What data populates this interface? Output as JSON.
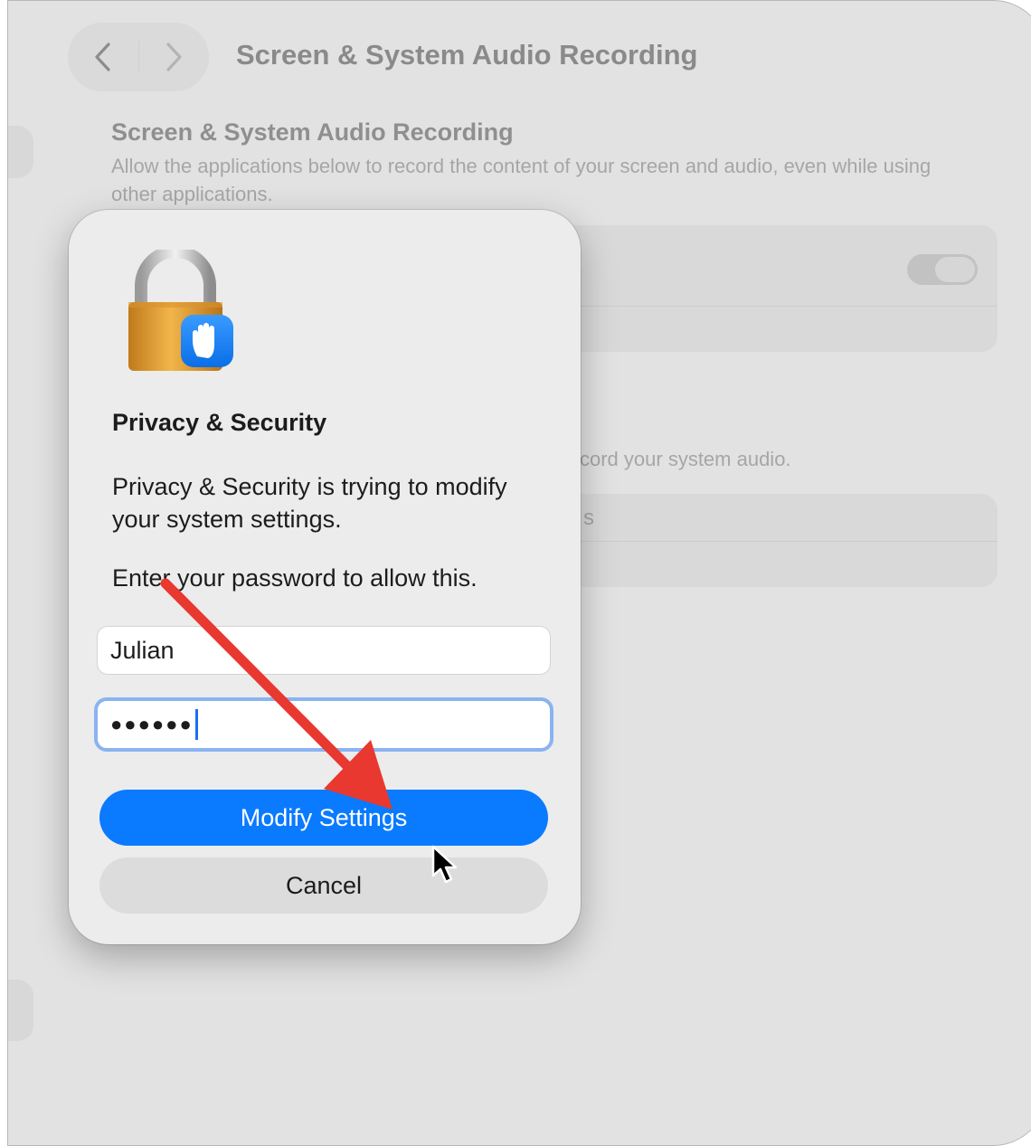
{
  "window": {
    "title": "Screen & System Audio Recording",
    "back_icon": "chevron-left-icon",
    "forward_icon": "chevron-right-icon"
  },
  "content": {
    "section_heading": "Screen & System Audio Recording",
    "section_description": "Allow the applications below to record the content of your screen and audio, even while using other applications.",
    "partial_audio_text": "cord your system audio.",
    "partial_list_text": "s"
  },
  "dialog": {
    "icon": "privacy-lock-icon",
    "title": "Privacy & Security",
    "message": "Privacy & Security is trying to modify your system settings.",
    "prompt": "Enter your password to allow this.",
    "username_value": "Julian",
    "password_masked": "●●●●●●",
    "primary_button": "Modify Settings",
    "secondary_button": "Cancel"
  },
  "colors": {
    "accent": "#0a7aff",
    "annotation_arrow": "#e8382f"
  }
}
